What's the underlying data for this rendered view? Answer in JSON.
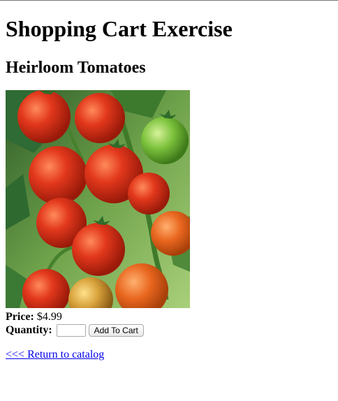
{
  "page": {
    "title": "Shopping Cart Exercise",
    "product_name": "Heirloom Tomatoes"
  },
  "product": {
    "price_label": "Price:",
    "price_value": "$4.99",
    "quantity_label": "Quantity:",
    "quantity_value": "",
    "add_button_label": "Add To Cart"
  },
  "nav": {
    "return_link": "<<< Return to catalog"
  }
}
